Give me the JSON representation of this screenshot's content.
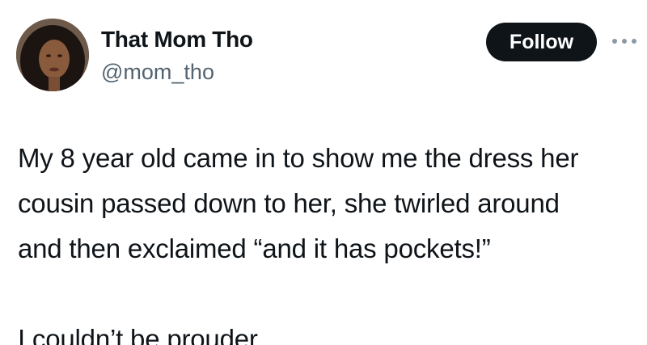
{
  "author": {
    "display_name": "That Mom Tho",
    "handle": "@mom_tho",
    "avatar_icon": "profile-photo"
  },
  "actions": {
    "follow_label": "Follow",
    "more_icon": "ellipsis-icon"
  },
  "tweet": {
    "lines": [
      "My 8 year old came in to show me the dress her",
      "cousin passed down to her, she twirled around",
      "and then exclaimed “and it has pockets!”"
    ],
    "closing": "I couldn’t be prouder"
  },
  "colors": {
    "text": "#0f1419",
    "secondary_text": "#536471",
    "button_bg": "#0f1419",
    "button_text": "#ffffff"
  }
}
